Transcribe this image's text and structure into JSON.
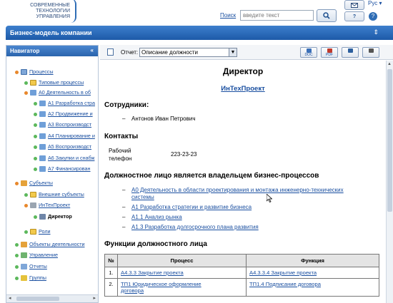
{
  "logo": {
    "line1": "СОВРЕМЕННЫЕ",
    "line2": "ТЕХНОЛОГИИ",
    "line3": "УПРАВЛЕНИЯ"
  },
  "search": {
    "link": "Поиск",
    "placeholder": "введите текст"
  },
  "lang": "Рус",
  "header": {
    "title": "Бизнес-модель компании"
  },
  "navigator": {
    "title": "Навигатор",
    "items": [
      {
        "label": "Процессы"
      },
      {
        "label": "Типовые процессы"
      },
      {
        "label": "А0 Деятельность в об"
      },
      {
        "label": "А1 Разработка стра"
      },
      {
        "label": "А2 Продвижение и"
      },
      {
        "label": "А3 Воспроизводст"
      },
      {
        "label": "А4 Планирование и"
      },
      {
        "label": "А5 Воспроизводст"
      },
      {
        "label": "А6 Закупки и снабж"
      },
      {
        "label": "А7 Финансирован"
      },
      {
        "label": "Субъекты"
      },
      {
        "label": "Внешние субъекты"
      },
      {
        "label": "ИнТехПроект"
      },
      {
        "label": "Директор"
      },
      {
        "label": "Роли"
      },
      {
        "label": "Объекты деятельности"
      },
      {
        "label": "Управление"
      },
      {
        "label": "Отчеты"
      },
      {
        "label": "Группы"
      }
    ]
  },
  "report": {
    "label": "Отчет:",
    "selected": "Описание должности",
    "exports": [
      "DOC",
      "PDF",
      "",
      ""
    ]
  },
  "doc": {
    "title": "Директор",
    "org": "ИнТехПроект",
    "employees_heading": "Сотрудники:",
    "employee": "Антонов Иван Петрович",
    "contacts_heading": "Контакты",
    "phone_label_1": "Рабочий",
    "phone_label_2": "телефон",
    "phone_value": "223-23-23",
    "owner_heading": "Должностное лицо является владельцем бизнес-процессов",
    "processes": [
      "А0 Деятельность в области проектирования и монтажа инженерно-технических",
      "системы",
      "А1 Разработка стратегии и развитие бизнеса",
      "А1.1 Анализ рынка",
      "А1.3 Разработка долгосрочного плана развития"
    ],
    "functions_heading": "Функции должностного лица",
    "table": {
      "headers": [
        "№",
        "Процесс",
        "Функция"
      ],
      "rows": [
        {
          "n": "1.",
          "process": "А4.3.3 Закрытие проекта",
          "process2": "",
          "function": "А4.3.3.4 Закрытие проекта"
        },
        {
          "n": "2.",
          "process": "ТП1 Юридическое оформление",
          "process2": "договора",
          "function": "ТП1.4 Подписание договора"
        }
      ]
    }
  },
  "colors": {
    "accent": "#1d5aa8",
    "link": "#1a4fa0",
    "bullet_green": "#5cb85c",
    "bullet_orange": "#e8882c"
  }
}
